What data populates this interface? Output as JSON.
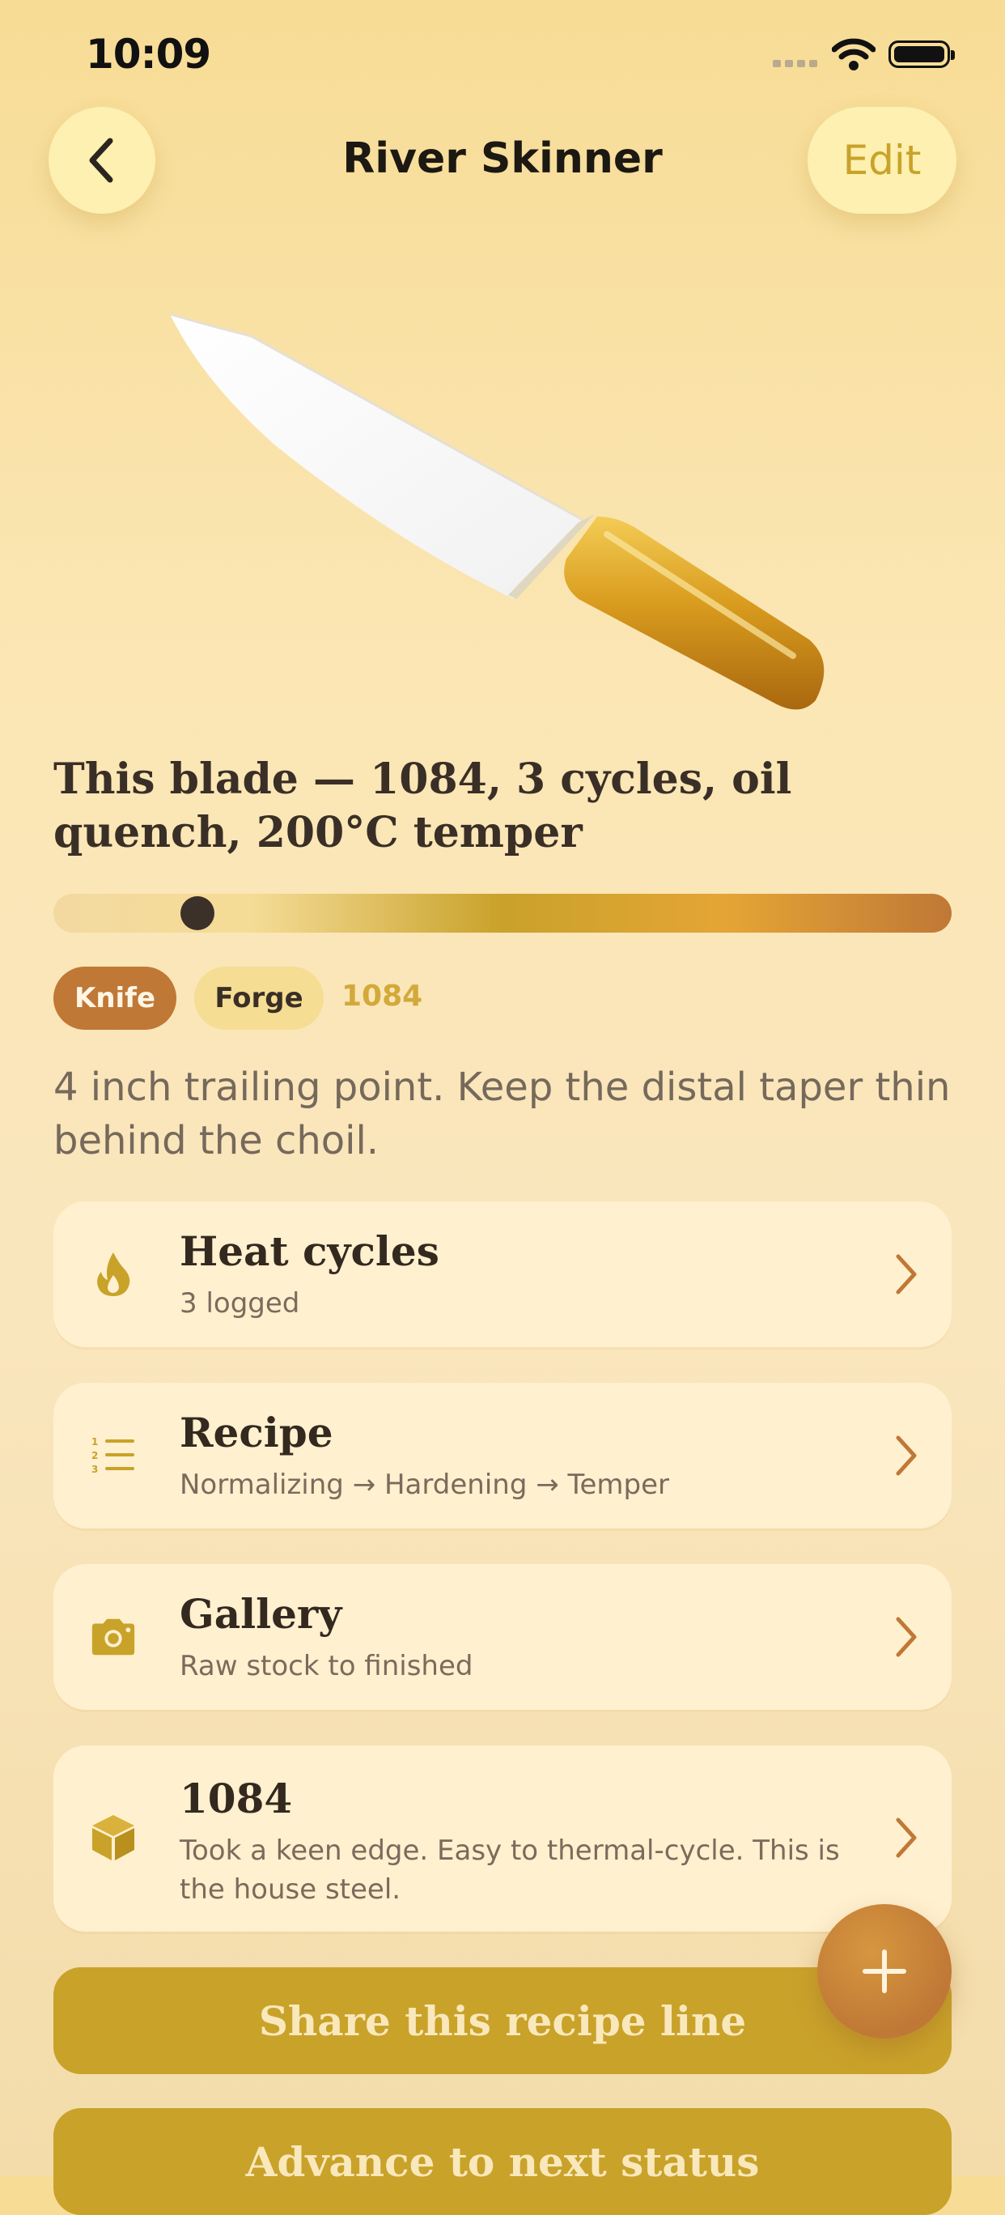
{
  "status_bar": {
    "time": "10:09"
  },
  "nav": {
    "title": "River Skinner",
    "edit_label": "Edit"
  },
  "headline": "This blade — 1084, 3 cycles, oil quench, 200°C temper",
  "progress": {
    "position_fraction": 0.16
  },
  "tags": {
    "type": "Knife",
    "category": "Forge",
    "steel": "1084"
  },
  "description": "4 inch trailing point. Keep the distal taper thin behind the choil.",
  "cards": [
    {
      "title": "Heat cycles",
      "subtitle": "3 logged",
      "icon": "flame-icon"
    },
    {
      "title": "Recipe",
      "subtitle": "Normalizing → Hardening → Temper",
      "icon": "numbered-list-icon"
    },
    {
      "title": "Gallery",
      "subtitle": "Raw stock to finished",
      "icon": "camera-icon"
    },
    {
      "title": "1084",
      "subtitle": "Took a keen edge. Easy to thermal-cycle. This is the house steel.",
      "icon": "cube-icon"
    }
  ],
  "actions": {
    "share_label": "Share this recipe line",
    "advance_label": "Advance to next status"
  },
  "colors": {
    "accent_gold": "#c9a22a",
    "accent_copper": "#c07836",
    "card_bg": "#fff0cf",
    "chip_bg": "#fdf0b0"
  }
}
